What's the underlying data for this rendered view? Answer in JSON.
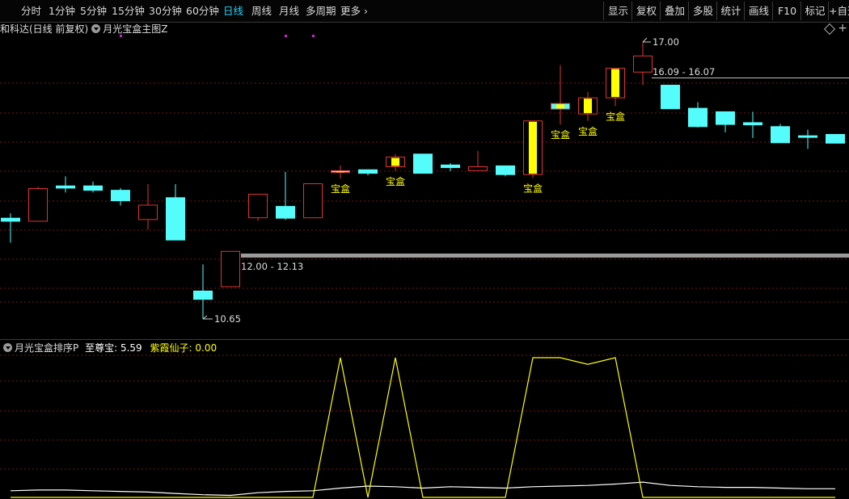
{
  "toolbar": {
    "periods": [
      "分时",
      "1分钟",
      "5分钟",
      "15分钟",
      "30分钟",
      "60分钟",
      "日线",
      "周线",
      "月线",
      "多周期",
      "更多"
    ],
    "active_period": "日线",
    "more_arrow": "›",
    "right_buttons": [
      "显示",
      "复权",
      "叠加",
      "多股",
      "统计",
      "画线",
      "F10",
      "标记",
      "+自选"
    ]
  },
  "main_panel": {
    "stock_name": "和科达(日线 前复权)",
    "indicator_name": "月光宝盒主图Z",
    "icons": [
      "dropdown-icon",
      "diamond-icon",
      "plus-icon"
    ]
  },
  "sub_panel": {
    "indicator_name": "月光宝盒排序P",
    "series": [
      {
        "label": "至尊宝:",
        "value": "5.59",
        "color": "#ffffff"
      },
      {
        "label": "紫霞仙子:",
        "value": "0.00",
        "color": "#ffff00"
      }
    ]
  },
  "chart_data": [
    {
      "type": "candlestick",
      "ohlc": [
        {
          "o": 12.96,
          "h": 13.07,
          "l": 12.4,
          "c": 12.89
        },
        {
          "o": 12.89,
          "h": 13.68,
          "l": 12.89,
          "c": 13.64
        },
        {
          "o": 13.7,
          "h": 13.92,
          "l": 13.55,
          "c": 13.65
        },
        {
          "o": 13.7,
          "h": 13.8,
          "l": 13.55,
          "c": 13.6
        },
        {
          "o": 13.6,
          "h": 13.65,
          "l": 13.25,
          "c": 13.36
        },
        {
          "o": 12.93,
          "h": 13.74,
          "l": 12.7,
          "c": 13.26
        },
        {
          "o": 13.43,
          "h": 13.74,
          "l": 12.46,
          "c": 12.46
        },
        {
          "o": 11.29,
          "h": 11.9,
          "l": 10.65,
          "c": 11.1
        },
        {
          "o": 11.39,
          "h": 12.2,
          "l": 11.39,
          "c": 12.2
        },
        {
          "o": 12.97,
          "h": 12.97,
          "l": 12.9,
          "c": 13.51
        },
        {
          "o": 13.23,
          "h": 14.02,
          "l": 12.92,
          "c": 12.96
        },
        {
          "o": 12.97,
          "h": 13.75,
          "l": 12.97,
          "c": 13.75
        },
        {
          "o": 14.05,
          "h": 14.17,
          "l": 13.87,
          "c": 14.01
        },
        {
          "o": 14.07,
          "h": 14.08,
          "l": 13.94,
          "c": 13.99
        },
        {
          "o": 14.14,
          "h": 14.43,
          "l": 14.04,
          "c": 14.36
        },
        {
          "o": 14.43,
          "h": 14.43,
          "l": 13.99,
          "c": 13.99
        },
        {
          "o": 14.18,
          "h": 14.22,
          "l": 14.04,
          "c": 14.12
        },
        {
          "o": 14.05,
          "h": 14.5,
          "l": 14.05,
          "c": 14.14
        },
        {
          "o": 14.16,
          "h": 14.16,
          "l": 13.92,
          "c": 13.96
        },
        {
          "o": 13.96,
          "h": 15.19,
          "l": 13.88,
          "c": 15.19
        },
        {
          "o": 15.59,
          "h": 16.47,
          "l": 15.11,
          "c": 15.46
        },
        {
          "o": 15.35,
          "h": 15.85,
          "l": 15.19,
          "c": 15.72
        },
        {
          "o": 15.72,
          "h": 16.4,
          "l": 15.53,
          "c": 16.4
        },
        {
          "o": 16.31,
          "h": 17.0,
          "l": 16.01,
          "c": 16.68
        },
        {
          "o": 16.01,
          "h": 16.01,
          "l": 15.47,
          "c": 15.47
        },
        {
          "o": 15.48,
          "h": 15.62,
          "l": 15.04,
          "c": 15.06
        },
        {
          "o": 15.4,
          "h": 15.4,
          "l": 14.93,
          "c": 15.11
        },
        {
          "o": 15.15,
          "h": 15.4,
          "l": 14.8,
          "c": 15.1
        },
        {
          "o": 15.06,
          "h": 15.12,
          "l": 14.69,
          "c": 14.69
        },
        {
          "o": 14.85,
          "h": 14.99,
          "l": 14.55,
          "c": 14.84
        },
        {
          "o": 14.88,
          "h": 14.88,
          "l": 14.68,
          "c": 14.68
        }
      ],
      "treasure_box_markers": [
        12,
        14,
        19,
        20,
        21,
        22
      ],
      "marker_label": "宝盒",
      "price_annotations": [
        {
          "index": 23,
          "value": "17.00",
          "kind": "high"
        },
        {
          "index": 7,
          "value": "10.65",
          "kind": "low"
        }
      ],
      "range_lines": [
        {
          "label": "16.09 - 16.07"
        },
        {
          "label": "12.00 - 12.13"
        }
      ]
    },
    {
      "type": "line",
      "series": [
        {
          "name": "至尊宝",
          "color": "#ffffff",
          "values": [
            1.0,
            1.1,
            1.1,
            1.0,
            0.9,
            0.8,
            0.6,
            0.4,
            0.3,
            0.7,
            0.9,
            1.0,
            1.4,
            1.7,
            1.6,
            1.4,
            1.6,
            1.5,
            1.4,
            1.6,
            1.7,
            1.8,
            2.0,
            2.3,
            1.8,
            1.6,
            1.5,
            1.5,
            1.4,
            1.3,
            1.3
          ]
        },
        {
          "name": "紫霞仙子",
          "color": "#ffff00",
          "values": [
            0,
            0,
            0,
            0,
            0,
            0,
            0,
            0,
            0,
            0,
            0,
            0,
            21.0,
            0,
            21.0,
            0,
            0,
            0,
            0,
            21.0,
            21.0,
            20.0,
            21.0,
            0,
            0,
            0,
            0,
            0,
            0,
            0,
            0
          ]
        }
      ]
    }
  ]
}
